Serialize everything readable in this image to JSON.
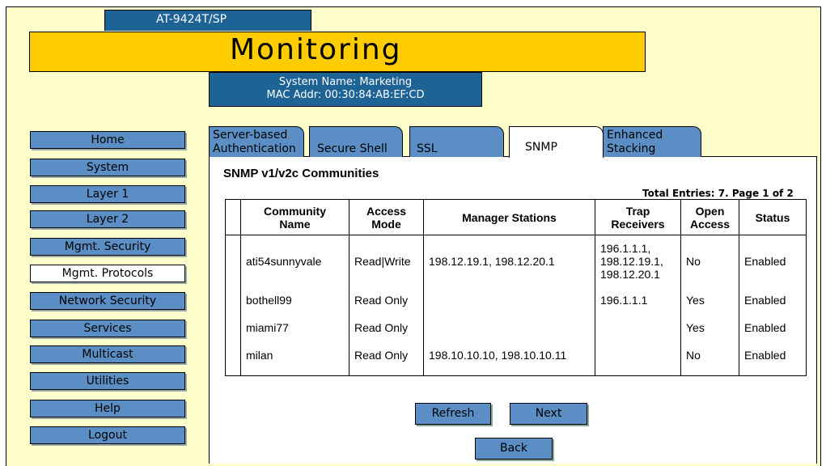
{
  "header": {
    "model": "AT-9424T/SP",
    "title": "Monitoring",
    "system_name": "System Name: Marketing",
    "mac_addr": "MAC Addr: 00:30:84:AB:EF:CD"
  },
  "nav": [
    {
      "label": "Home"
    },
    {
      "label": "System"
    },
    {
      "label": "Layer 1"
    },
    {
      "label": "Layer 2"
    },
    {
      "label": "Mgmt. Security"
    },
    {
      "label": "Mgmt. Protocols"
    },
    {
      "label": "Network Security"
    },
    {
      "label": "Services"
    },
    {
      "label": "Multicast"
    },
    {
      "label": "Utilities"
    },
    {
      "label": "Help"
    },
    {
      "label": "Logout"
    }
  ],
  "tabs": [
    {
      "line1": "Server-based",
      "line2": "Authentication"
    },
    {
      "line1": "",
      "line2": "Secure Shell"
    },
    {
      "line1": "",
      "line2": "SSL"
    },
    {
      "line1": "",
      "line2": "SNMP"
    },
    {
      "line1": "Enhanced",
      "line2": "Stacking"
    }
  ],
  "section": {
    "title": "SNMP v1/v2c Communities",
    "total_entries": "Total Entries: 7. Page 1 of 2"
  },
  "table": {
    "headers": {
      "community_name": [
        "Community",
        "Name"
      ],
      "access_mode": [
        "Access",
        "Mode"
      ],
      "manager_stations": "Manager Stations",
      "trap_receivers": [
        "Trap",
        "Receivers"
      ],
      "open_access": [
        "Open",
        "Access"
      ],
      "status": "Status"
    },
    "rows": [
      {
        "community_name": "ati54sunnyvale",
        "access_mode": "Read|Write",
        "manager_stations": "198.12.19.1, 198.12.20.1",
        "trap_receivers": [
          "196.1.1.1,",
          "198.12.19.1,",
          "198.12.20.1"
        ],
        "open_access": "No",
        "status": "Enabled"
      },
      {
        "community_name": "bothell99",
        "access_mode": "Read Only",
        "manager_stations": "",
        "trap_receivers": [
          "196.1.1.1",
          "",
          ""
        ],
        "open_access": "Yes",
        "status": "Enabled"
      },
      {
        "community_name": "miami77",
        "access_mode": "Read Only",
        "manager_stations": "",
        "trap_receivers": [
          "",
          "",
          ""
        ],
        "open_access": "Yes",
        "status": "Enabled"
      },
      {
        "community_name": "milan",
        "access_mode": "Read Only",
        "manager_stations": "198.10.10.10, 198.10.10.11",
        "trap_receivers": [
          "",
          "",
          ""
        ],
        "open_access": "No",
        "status": "Enabled"
      }
    ]
  },
  "buttons": {
    "refresh": "Refresh",
    "next": "Next",
    "back": "Back"
  },
  "colors": {
    "page_bg": "#ffffcc",
    "title_bar": "#ffcc00",
    "header_blue": "#1e6396",
    "button_blue": "#5b8ec4"
  }
}
